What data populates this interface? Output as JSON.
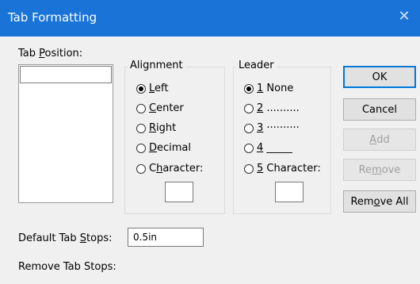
{
  "window": {
    "title": "Tab Formatting",
    "close_glyph": "✕"
  },
  "tab_position": {
    "label_pre": "Tab ",
    "label_key": "P",
    "label_post": "osition:"
  },
  "alignment": {
    "title": "Alignment",
    "options": [
      {
        "pre": "",
        "key": "L",
        "post": "eft",
        "selected": true
      },
      {
        "pre": "",
        "key": "C",
        "post": "enter",
        "selected": false
      },
      {
        "pre": "",
        "key": "R",
        "post": "ight",
        "selected": false
      },
      {
        "pre": "",
        "key": "D",
        "post": "ecimal",
        "selected": false
      },
      {
        "pre": "C",
        "key": "h",
        "post": "aracter:",
        "selected": false
      }
    ]
  },
  "leader": {
    "title": "Leader",
    "options": [
      {
        "pre": "",
        "key": "1",
        "post": " None",
        "selected": true
      },
      {
        "pre": "",
        "key": "2",
        "post": " ..........",
        "selected": false
      },
      {
        "pre": "",
        "key": "3",
        "post": " ··········",
        "selected": false
      },
      {
        "pre": "",
        "key": "4",
        "post": " _____",
        "selected": false
      },
      {
        "pre": "",
        "key": "5",
        "post": " Character:",
        "selected": false
      }
    ]
  },
  "buttons": {
    "ok": "OK",
    "cancel": "Cancel",
    "add_pre": "",
    "add_key": "A",
    "add_post": "dd",
    "remove_pre": "Re",
    "remove_key": "m",
    "remove_post": "ove",
    "remove_all_pre": "Rem",
    "remove_all_key": "o",
    "remove_all_post": "ve All"
  },
  "default_tab_stops": {
    "label_pre": "Default Tab ",
    "label_key": "S",
    "label_post": "tops:",
    "value": "0.5in"
  },
  "remove_tab_stops": {
    "label": "Remove Tab Stops:"
  },
  "colors": {
    "titlebar": "#1a73d6",
    "default_border": "#0078d7"
  }
}
